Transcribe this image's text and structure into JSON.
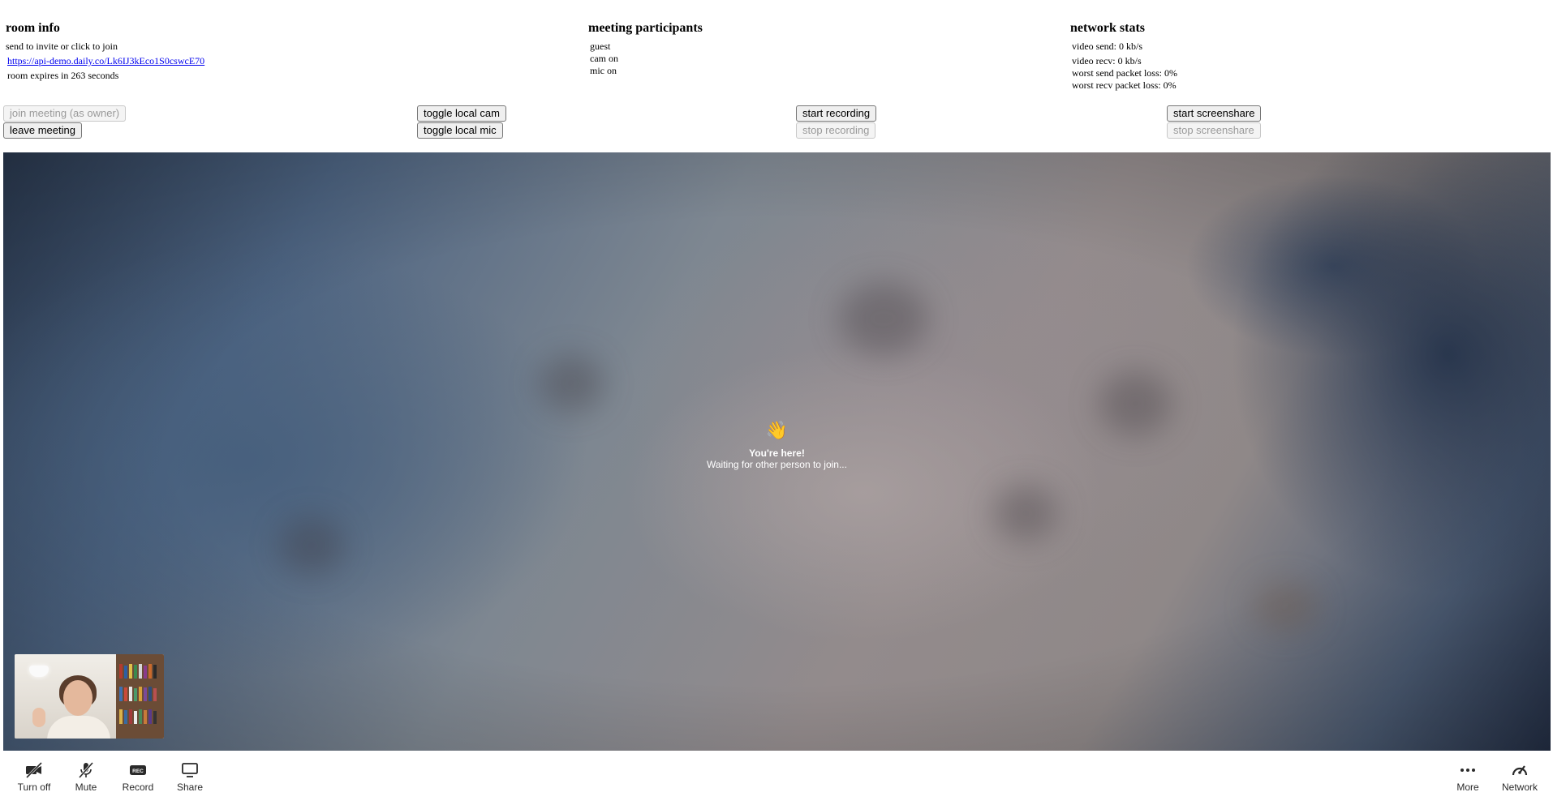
{
  "room_info": {
    "heading": "room info",
    "invite_text": "send to invite or click to join",
    "link": "https://api-demo.daily.co/Lk6IJ3kEco1S0cswcE70",
    "expires": "room expires in 263 seconds"
  },
  "participants": {
    "heading": "meeting participants",
    "name": "guest",
    "cam": "cam on",
    "mic": "mic on"
  },
  "network": {
    "heading": "network stats",
    "video_send": "video send: 0 kb/s",
    "video_recv": "video recv: 0 kb/s",
    "worst_send": "worst send packet loss: 0%",
    "worst_recv": "worst recv packet loss: 0%"
  },
  "buttons": {
    "join": "join meeting (as owner)",
    "leave": "leave meeting",
    "toggle_cam": "toggle local cam",
    "toggle_mic": "toggle local mic",
    "start_recording": "start recording",
    "stop_recording": "stop recording",
    "start_screenshare": "start screenshare",
    "stop_screenshare": "stop screenshare"
  },
  "call": {
    "wave": "👋",
    "title": "You're here!",
    "subtitle": "Waiting for other person to join..."
  },
  "toolbar": {
    "turn_off": "Turn off",
    "mute": "Mute",
    "record": "Record",
    "share": "Share",
    "more": "More",
    "network": "Network"
  },
  "icons": {
    "camera_off": "video-off-icon",
    "mic_off": "mic-off-icon",
    "record": "rec-icon",
    "share": "monitor-icon",
    "more": "ellipsis-icon",
    "network": "gauge-icon"
  }
}
